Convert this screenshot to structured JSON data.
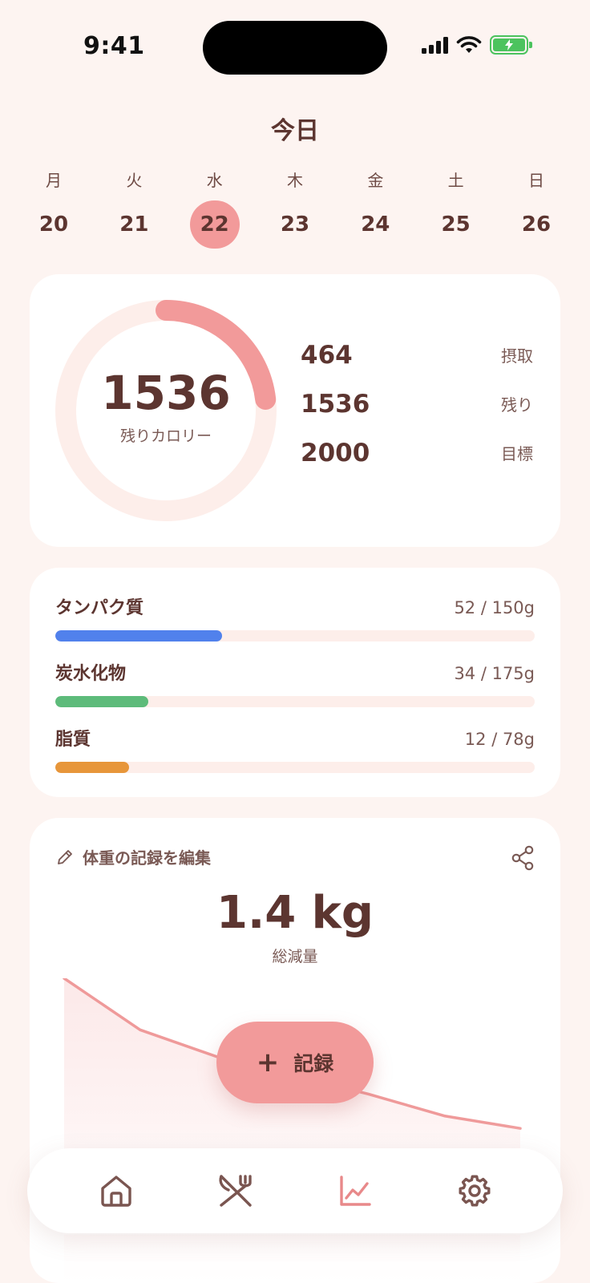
{
  "status_bar": {
    "time": "9:41"
  },
  "header": {
    "title": "今日"
  },
  "week": [
    {
      "name": "月",
      "num": "20",
      "selected": false
    },
    {
      "name": "火",
      "num": "21",
      "selected": false
    },
    {
      "name": "水",
      "num": "22",
      "selected": true
    },
    {
      "name": "木",
      "num": "23",
      "selected": false
    },
    {
      "name": "金",
      "num": "24",
      "selected": false
    },
    {
      "name": "土",
      "num": "25",
      "selected": false
    },
    {
      "name": "日",
      "num": "26",
      "selected": false
    }
  ],
  "calories": {
    "remaining": "1536",
    "remaining_label": "残りカロリー",
    "progress_fraction": 0.232,
    "stats": [
      {
        "value": "464",
        "label": "摂取"
      },
      {
        "value": "1536",
        "label": "残り"
      },
      {
        "value": "2000",
        "label": "目標"
      }
    ]
  },
  "macros": [
    {
      "name": "タンパク質",
      "amount": "52 / 150g",
      "fraction": 0.347,
      "color": "#5181ec"
    },
    {
      "name": "炭水化物",
      "amount": "34 / 175g",
      "fraction": 0.194,
      "color": "#5dbb7a"
    },
    {
      "name": "脂質",
      "amount": "12 / 78g",
      "fraction": 0.154,
      "color": "#e7963a"
    }
  ],
  "weight": {
    "edit_label": "体重の記録を編集",
    "value": "1.4 kg",
    "label": "総減量",
    "trend": [
      1.0,
      0.67,
      0.5,
      0.38,
      0.26,
      0.12,
      0.04
    ]
  },
  "fab": {
    "plus": "+",
    "label": "記録"
  },
  "nav": [
    {
      "icon": "home-icon",
      "active": false
    },
    {
      "icon": "fork-knife-icon",
      "active": false
    },
    {
      "icon": "chart-icon",
      "active": true
    },
    {
      "icon": "gear-icon",
      "active": false
    }
  ],
  "colors": {
    "accent": "#f29a9a",
    "text": "#5c3530",
    "background": "#fdf4f1",
    "track": "#fdeeea",
    "battery": "#4cc35e"
  }
}
